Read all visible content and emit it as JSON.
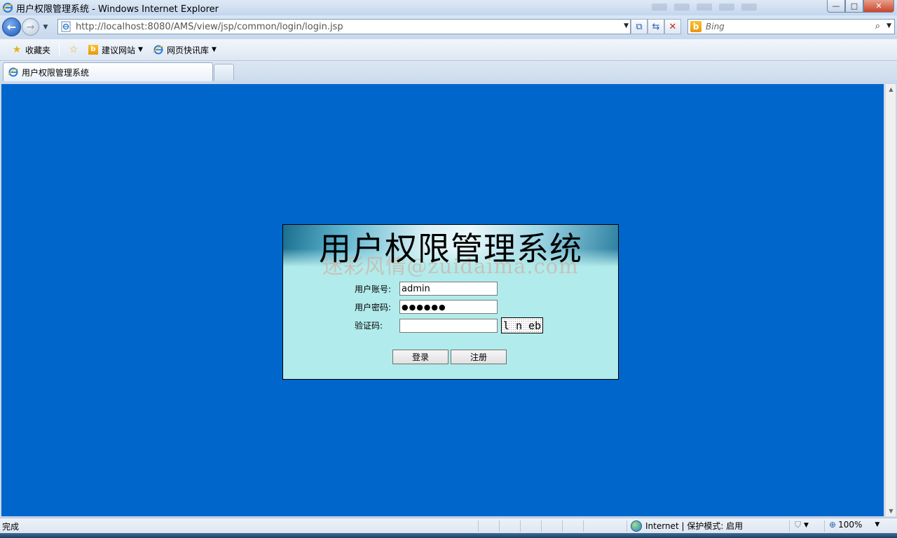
{
  "window": {
    "title": "用户权限管理系统 - Windows Internet Explorer",
    "min_glyph": "—",
    "max_glyph": "□",
    "close_glyph": "✕"
  },
  "navigation": {
    "url": "http://localhost:8080/AMS/view/jsp/common/login/login.jsp",
    "search_placeholder": "Bing",
    "back_glyph": "←",
    "forward_glyph": "→"
  },
  "favorites_bar": {
    "favorites_label": "收藏夹",
    "items": [
      {
        "label": "建议网站",
        "icon": "bing-icon"
      },
      {
        "label": "网页快讯库",
        "icon": "ie-icon"
      }
    ]
  },
  "tabs": [
    {
      "label": "用户权限管理系统",
      "active": true
    }
  ],
  "login": {
    "system_title": "用户权限管理系统",
    "watermark": "迷彩风情@zuidaima.com",
    "account_label": "用户账号:",
    "account_value": "admin",
    "password_label": "用户密码:",
    "password_value": "●●●●●●",
    "captcha_label": "验证码:",
    "captcha_value": "",
    "captcha_text": "l n eb",
    "login_button": "登录",
    "register_button": "注册"
  },
  "status_bar": {
    "status_text": "完成",
    "zone_text": "Internet | 保护模式: 启用",
    "zoom": "100%"
  },
  "colors": {
    "page_background": "#0066cc",
    "panel_background": "#b2ebeb"
  }
}
